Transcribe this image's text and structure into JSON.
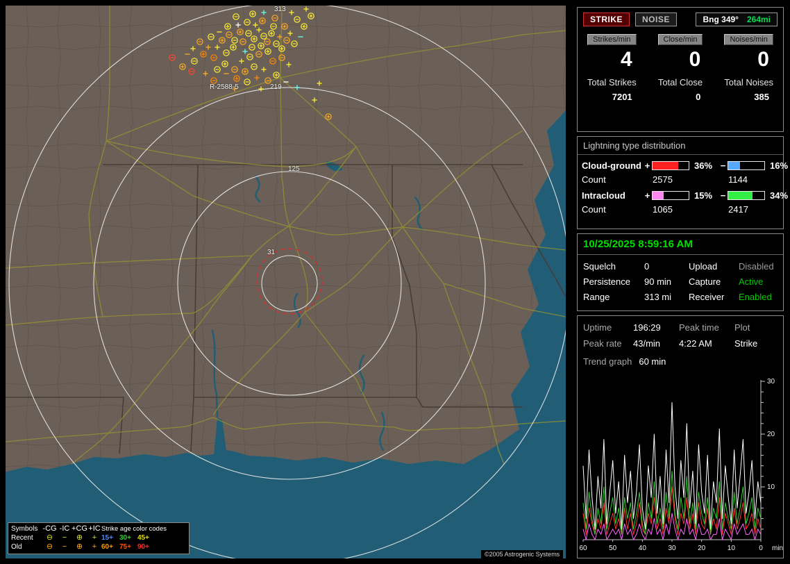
{
  "map": {
    "range_labels": [
      {
        "text": "313"
      },
      {
        "text": "219"
      },
      {
        "text": "125"
      },
      {
        "text": "31"
      }
    ],
    "area_label": "R-2588-5",
    "copyright": "©2005 Astrogenic Systems",
    "legend": {
      "symbols_header": "Symbols",
      "col_headers": [
        "-CG",
        "-IC",
        "+CG",
        "+IC"
      ],
      "age_title": "Strike age color codes",
      "sym_ncg": "⊖",
      "sym_nic": "−",
      "sym_pcg": "⊕",
      "sym_pic": "+",
      "rows": [
        {
          "label": "Recent",
          "symbol_color": "#d6e03a",
          "ages": [
            {
              "text": "15+",
              "color": "#4d8cff"
            },
            {
              "text": "30+",
              "color": "#35cc35"
            },
            {
              "text": "45+",
              "color": "#e0e000"
            }
          ]
        },
        {
          "label": "Old",
          "symbol_color": "#ffaa22",
          "ages": [
            {
              "text": "60+",
              "color": "#ff9900"
            },
            {
              "text": "75+",
              "color": "#ff5500"
            },
            {
              "text": "90+",
              "color": "#ff2a2a"
            }
          ]
        }
      ]
    },
    "strike_colors": {
      "Y": "#ffee33",
      "O": "#ffaa22",
      "D": "#ff8800",
      "R": "#ff4433",
      "C": "#66ffee",
      "W": "#ffffff"
    },
    "strikes": [
      [
        350,
        40,
        "ncg",
        "Y"
      ],
      [
        358,
        48,
        "pcg",
        "Y"
      ],
      [
        342,
        52,
        "ncg",
        "O"
      ],
      [
        365,
        35,
        "pic",
        "Y"
      ],
      [
        372,
        44,
        "ncg",
        "Y"
      ],
      [
        338,
        38,
        "pcg",
        "O"
      ],
      [
        355,
        60,
        "ncg",
        "Y"
      ],
      [
        368,
        58,
        "pcg",
        "Y"
      ],
      [
        345,
        66,
        "pic",
        "C"
      ],
      [
        330,
        50,
        "ncg",
        "Y"
      ],
      [
        377,
        52,
        "ncg",
        "O"
      ],
      [
        383,
        40,
        "pcg",
        "Y"
      ],
      [
        322,
        42,
        "ncg",
        "O"
      ],
      [
        360,
        28,
        "pic",
        "Y"
      ],
      [
        348,
        24,
        "ncg",
        "Y"
      ],
      [
        370,
        22,
        "pcg",
        "O"
      ],
      [
        335,
        28,
        "pic",
        "W"
      ],
      [
        328,
        60,
        "pcg",
        "Y"
      ],
      [
        352,
        74,
        "ncg",
        "Y"
      ],
      [
        340,
        80,
        "pic",
        "Y"
      ],
      [
        365,
        70,
        "ncg",
        "O"
      ],
      [
        378,
        66,
        "pcg",
        "Y"
      ],
      [
        390,
        55,
        "ncg",
        "Y"
      ],
      [
        395,
        45,
        "pic",
        "O"
      ],
      [
        386,
        30,
        "ncg",
        "Y"
      ],
      [
        312,
        50,
        "pcg",
        "O"
      ],
      [
        318,
        68,
        "ncg",
        "Y"
      ],
      [
        305,
        60,
        "pic",
        "Y"
      ],
      [
        398,
        62,
        "pcg",
        "Y"
      ],
      [
        405,
        50,
        "ncg",
        "O"
      ],
      [
        332,
        16,
        "ncg",
        "Y"
      ],
      [
        356,
        12,
        "pcg",
        "Y"
      ],
      [
        372,
        10,
        "pic",
        "C"
      ],
      [
        388,
        18,
        "ncg",
        "O"
      ],
      [
        320,
        30,
        "pcg",
        "Y"
      ],
      [
        308,
        38,
        "nic",
        "Y"
      ],
      [
        345,
        95,
        "pcg",
        "O"
      ],
      [
        358,
        88,
        "ncg",
        "Y"
      ],
      [
        372,
        92,
        "pic",
        "Y"
      ],
      [
        385,
        80,
        "ncg",
        "D"
      ],
      [
        330,
        92,
        "ncg",
        "O"
      ],
      [
        316,
        84,
        "pcg",
        "Y"
      ],
      [
        300,
        75,
        "ncg",
        "D"
      ],
      [
        292,
        60,
        "pic",
        "O"
      ],
      [
        296,
        45,
        "ncg",
        "Y"
      ],
      [
        410,
        40,
        "pic",
        "Y"
      ],
      [
        416,
        55,
        "ncg",
        "Y"
      ],
      [
        402,
        30,
        "pcg",
        "O"
      ],
      [
        420,
        20,
        "ncg",
        "Y"
      ],
      [
        412,
        10,
        "pic",
        "Y"
      ],
      [
        430,
        30,
        "pcg",
        "Y"
      ],
      [
        425,
        45,
        "nic",
        "C"
      ],
      [
        398,
        75,
        "ncg",
        "O"
      ],
      [
        408,
        85,
        "pic",
        "Y"
      ],
      [
        390,
        100,
        "pcg",
        "Y"
      ],
      [
        378,
        108,
        "ncg",
        "O"
      ],
      [
        362,
        104,
        "pic",
        "D"
      ],
      [
        348,
        110,
        "ncg",
        "Y"
      ],
      [
        333,
        105,
        "pcg",
        "D"
      ],
      [
        318,
        98,
        "nic",
        "O"
      ],
      [
        305,
        92,
        "ncg",
        "Y"
      ],
      [
        285,
        70,
        "pcg",
        "D"
      ],
      [
        280,
        52,
        "ncg",
        "O"
      ],
      [
        270,
        62,
        "pic",
        "Y"
      ],
      [
        255,
        88,
        "pcg",
        "O"
      ],
      [
        300,
        108,
        "ncg",
        "D"
      ],
      [
        288,
        98,
        "pic",
        "O"
      ],
      [
        272,
        80,
        "ncg",
        "Y"
      ],
      [
        262,
        70,
        "nic",
        "O"
      ],
      [
        440,
        15,
        "pcg",
        "Y"
      ],
      [
        433,
        5,
        "pic",
        "Y"
      ],
      [
        452,
        112,
        "pic",
        "Y"
      ],
      [
        465,
        160,
        "pcg",
        "O"
      ],
      [
        445,
        136,
        "pic",
        "Y"
      ],
      [
        420,
        118,
        "pic",
        "C"
      ],
      [
        368,
        120,
        "pic",
        "Y"
      ],
      [
        404,
        110,
        "nic",
        "W"
      ],
      [
        268,
        95,
        "ncg",
        "R"
      ],
      [
        240,
        75,
        "ncg",
        "R"
      ],
      [
        330,
        120,
        "pic",
        "O"
      ]
    ]
  },
  "panel": {
    "strike_button": "STRIKE",
    "noise_button": "NOISE",
    "bearing_label": "Bng 349°",
    "bearing_range": "264mi",
    "counters": [
      {
        "label": "Strikes/min",
        "value": "4",
        "total_label": "Total Strikes",
        "total": "7201"
      },
      {
        "label": "Close/min",
        "value": "0",
        "total_label": "Total Close",
        "total": "0"
      },
      {
        "label": "Noises/min",
        "value": "0",
        "total_label": "Total Noises",
        "total": "385"
      }
    ],
    "distribution": {
      "title": "Lightning type distribution",
      "plus_sign": "+",
      "minus_sign": "−",
      "count_label": "Count",
      "rows": [
        {
          "name": "Cloud-ground",
          "plus_pct": "36%",
          "plus_fill": 72,
          "plus_color": "#ff2222",
          "minus_pct": "16%",
          "minus_fill": 32,
          "minus_color": "#55aaff",
          "plus_count": "2575",
          "minus_count": "1144"
        },
        {
          "name": "Intracloud",
          "plus_pct": "15%",
          "plus_fill": 30,
          "plus_color": "#ff88ee",
          "minus_pct": "34%",
          "minus_fill": 68,
          "minus_color": "#33ee44",
          "plus_count": "1065",
          "minus_count": "2417"
        }
      ]
    },
    "status": {
      "datetime": "10/25/2025 8:59:16 AM",
      "rows": [
        {
          "l1": "Squelch",
          "v1": "0",
          "l2": "Upload",
          "v2": "Disabled",
          "v2_color": "#9a9a9a"
        },
        {
          "l1": "Persistence",
          "v1": "90 min",
          "l2": "Capture",
          "v2": "Active",
          "v2_color": "#00cc00"
        },
        {
          "l1": "Range",
          "v1": "313 mi",
          "l2": "Receiver",
          "v2": "Enabled",
          "v2_color": "#00cc00"
        }
      ]
    },
    "stats": {
      "uptime_label": "Uptime",
      "uptime": "196:29",
      "peak_time_label": "Peak time",
      "peak_time": "4:22 AM",
      "plot_label": "Plot",
      "plot": "Strike",
      "peak_rate_label": "Peak rate",
      "peak_rate": "43/min",
      "trend_label": "Trend graph",
      "trend_value": "60 min"
    }
  },
  "chart_data": {
    "type": "line",
    "title": "Trend graph 60 min",
    "x_unit": "min",
    "x_ticks": [
      60,
      50,
      40,
      30,
      20,
      10,
      0
    ],
    "y_ticks": [
      10,
      20,
      30
    ],
    "ylim": [
      0,
      30
    ],
    "legend_position": "none",
    "series": [
      {
        "name": "noises",
        "color": "#ff66ff",
        "values": [
          2,
          0,
          3,
          1,
          0,
          2,
          1,
          3,
          0,
          1,
          2,
          1,
          2,
          0,
          3,
          1,
          2,
          0,
          1,
          3,
          1,
          0,
          2,
          1,
          4,
          1,
          2,
          0,
          3,
          1,
          5,
          2,
          0,
          2,
          1,
          4,
          1,
          2,
          0,
          3,
          1,
          1,
          2,
          0,
          1,
          1,
          4,
          0,
          2,
          1,
          0,
          3,
          1,
          2,
          3,
          1,
          1,
          2,
          0,
          2,
          1
        ]
      },
      {
        "name": "cg_strikes",
        "color": "#ff3333",
        "values": [
          5,
          1,
          6,
          3,
          1,
          4,
          2,
          7,
          1,
          3,
          5,
          2,
          4,
          1,
          6,
          2,
          5,
          1,
          3,
          7,
          2,
          1,
          5,
          3,
          8,
          2,
          4,
          1,
          6,
          3,
          10,
          4,
          1,
          5,
          3,
          8,
          2,
          5,
          1,
          7,
          3,
          2,
          6,
          1,
          4,
          2,
          8,
          1,
          5,
          3,
          1,
          6,
          2,
          4,
          7,
          2,
          3,
          5,
          1,
          4,
          2
        ]
      },
      {
        "name": "ic_strikes",
        "color": "#33cc33",
        "values": [
          7,
          2,
          9,
          4,
          1,
          6,
          3,
          10,
          2,
          5,
          8,
          3,
          6,
          1,
          8,
          4,
          7,
          2,
          5,
          9,
          3,
          1,
          7,
          4,
          11,
          3,
          6,
          2,
          9,
          4,
          13,
          5,
          2,
          8,
          4,
          12,
          3,
          7,
          2,
          9,
          5,
          3,
          8,
          1,
          6,
          4,
          11,
          2,
          7,
          4,
          2,
          9,
          3,
          6,
          10,
          3,
          5,
          8,
          2,
          6,
          4
        ]
      },
      {
        "name": "total_strikes",
        "color": "#ffffff",
        "values": [
          14,
          4,
          17,
          8,
          2,
          12,
          6,
          19,
          3,
          9,
          15,
          5,
          11,
          2,
          16,
          7,
          13,
          4,
          9,
          18,
          6,
          2,
          14,
          8,
          20,
          5,
          12,
          3,
          17,
          7,
          26,
          10,
          4,
          15,
          8,
          22,
          6,
          13,
          3,
          18,
          9,
          5,
          16,
          2,
          11,
          7,
          21,
          4,
          14,
          8,
          3,
          17,
          6,
          12,
          19,
          5,
          9,
          15,
          4,
          11,
          7
        ]
      }
    ]
  }
}
